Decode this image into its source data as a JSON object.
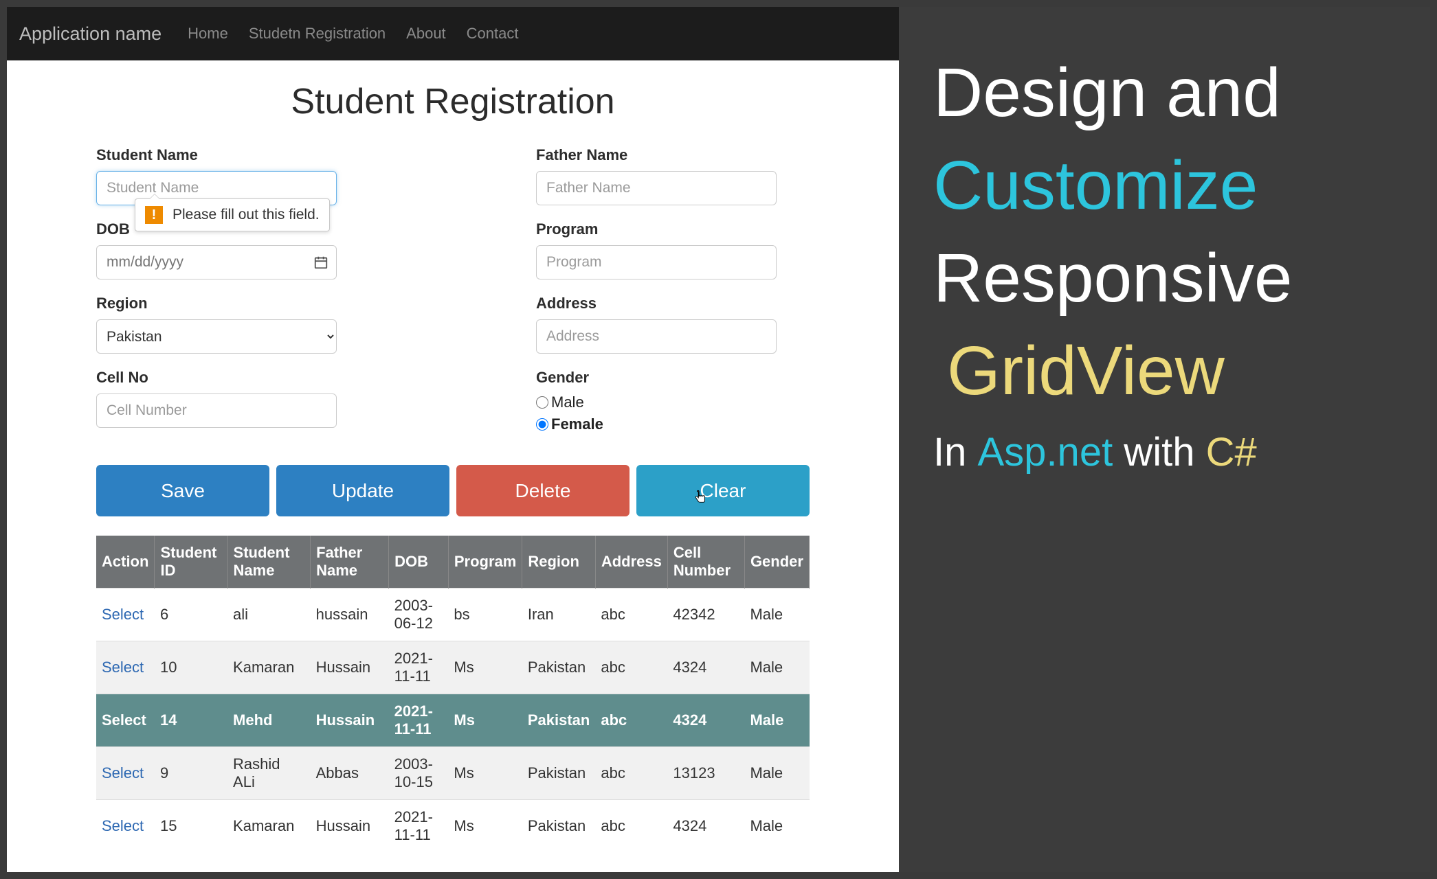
{
  "nav": {
    "brand": "Application name",
    "items": [
      "Home",
      "Studetn Registration",
      "About",
      "Contact"
    ]
  },
  "page": {
    "title": "Student Registration"
  },
  "form": {
    "student_name": {
      "label": "Student Name",
      "placeholder": "Student Name",
      "value": ""
    },
    "father_name": {
      "label": "Father Name",
      "placeholder": "Father Name",
      "value": ""
    },
    "dob": {
      "label": "DOB",
      "placeholder": "mm/dd/yyyy",
      "value": ""
    },
    "program": {
      "label": "Program",
      "placeholder": "Program",
      "value": ""
    },
    "region": {
      "label": "Region",
      "selected": "Pakistan"
    },
    "address": {
      "label": "Address",
      "placeholder": "Address",
      "value": ""
    },
    "cell": {
      "label": "Cell No",
      "placeholder": "Cell Number",
      "value": ""
    },
    "gender": {
      "label": "Gender",
      "male": "Male",
      "female": "Female",
      "selected": "Female"
    },
    "validation": "Please fill out this field."
  },
  "buttons": {
    "save": "Save",
    "update": "Update",
    "delete": "Delete",
    "clear": "Clear"
  },
  "grid": {
    "headers": [
      "Action",
      "Student ID",
      "Student Name",
      "Father Name",
      "DOB",
      "Program",
      "Region",
      "Address",
      "Cell Number",
      "Gender"
    ],
    "select_label": "Select",
    "rows": [
      {
        "id": "6",
        "name": "ali",
        "father": "hussain",
        "dob": "2003-06-12",
        "program": "bs",
        "region": "Iran",
        "address": "abc",
        "cell": "42342",
        "gender": "Male",
        "alt": false,
        "sel": false
      },
      {
        "id": "10",
        "name": "Kamaran",
        "father": "Hussain",
        "dob": "2021-11-11",
        "program": "Ms",
        "region": "Pakistan",
        "address": "abc",
        "cell": "4324",
        "gender": "Male",
        "alt": true,
        "sel": false
      },
      {
        "id": "14",
        "name": "Mehd",
        "father": "Hussain",
        "dob": "2021-11-11",
        "program": "Ms",
        "region": "Pakistan",
        "address": "abc",
        "cell": "4324",
        "gender": "Male",
        "alt": false,
        "sel": true
      },
      {
        "id": "9",
        "name": "Rashid ALi",
        "father": "Abbas",
        "dob": "2003-10-15",
        "program": "Ms",
        "region": "Pakistan",
        "address": "abc",
        "cell": "13123",
        "gender": "Male",
        "alt": true,
        "sel": false
      },
      {
        "id": "15",
        "name": "Kamaran",
        "father": "Hussain",
        "dob": "2021-11-11",
        "program": "Ms",
        "region": "Pakistan",
        "address": "abc",
        "cell": "4324",
        "gender": "Male",
        "alt": false,
        "sel": false
      }
    ]
  },
  "side": {
    "l1": "Design and",
    "l2": "Customize",
    "l3": "Responsive",
    "l4": "GridView",
    "sub_in": "In ",
    "sub_asp": "Asp.net",
    "sub_with": " with ",
    "sub_cs": "C#"
  }
}
